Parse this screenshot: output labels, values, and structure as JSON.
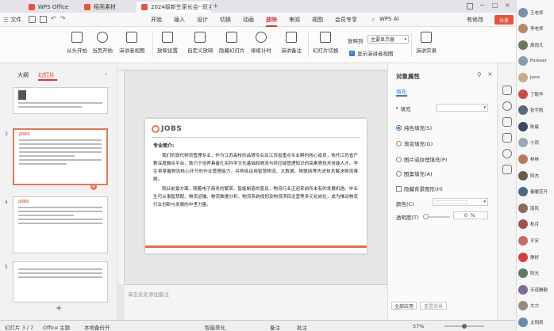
{
  "tabs": [
    {
      "label": "WPS Office",
      "color": "#e8523f"
    },
    {
      "label": "稻壳素材",
      "color": "#e8523f"
    },
    {
      "label": "2024级新生家长会--班主任",
      "color": "#e8523f"
    }
  ],
  "wps_ai": "WPS AI",
  "menu": {
    "file": "三 文件",
    "items": [
      "开始",
      "插入",
      "设计",
      "切换",
      "动画",
      "放映",
      "审阅",
      "视图",
      "会员专享"
    ],
    "active": "放映",
    "changes": "有修改",
    "share": "分享"
  },
  "ribbon": {
    "buttons": [
      "从头开始",
      "当页开始",
      "演讲者视图",
      "放映设置",
      "自定义放映",
      "隐藏幻灯片",
      "排练计时",
      "演讲备注",
      "幻灯片切换",
      "演讲实录"
    ],
    "monitor_label": "放映到",
    "monitor_value": "主要显示器",
    "presenter_view": "显示演讲者视图"
  },
  "left_panel": {
    "tab_outline": "大纲",
    "tab_slides": "幻灯片",
    "slide_numbers": [
      "3",
      "4",
      "5"
    ],
    "logo": "JOBS"
  },
  "slide": {
    "logo": "JOBS",
    "heading": "专业简介:",
    "para1": "我们的现代物流管理专业，作为江苏高校的品牌专业及江苏省重点专业群的核心成员，依托江苏省产教深度融合平台，致力于培养具备扎实科学文化基础和物流与供应链管理知识的高素质技术技能人才。学生将掌握物流核心环节的作业管理能力，并熟练运用智慧物流、大数据、物联网等先进技术解决物流难题。",
    "para2": "就业前景方面，随着电子商务的繁荣、智能制造的普及，物流行业正迎来前所未有的发展机遇。毕业生可从事智慧配、物流运输、物流数据分析、物流系统规划及物流项目运营等多元化岗位，成为推动物流行业创新与发展的中坚力量。"
  },
  "notes_placeholder": "单击此处添加备注",
  "right_panel": {
    "title": "对象属性",
    "tab_fill": "填充",
    "fill_label": "填充",
    "options": [
      "纯色填充(S)",
      "渐变填充(G)",
      "图片或纹理填充(P)",
      "图案填充(A)",
      "隐藏背景图形(H)"
    ],
    "selected": "纯色填充(S)",
    "color_label": "颜色(C)",
    "transparency_label": "透明度(T)",
    "transparency_value": "0",
    "transparency_unit": "%",
    "apply_all": "全部应用",
    "reset_bg": "重置背景"
  },
  "status": {
    "slide_count": "幻灯片 3 / 7",
    "theme": "Office 主题",
    "backup": "本地备份开",
    "beautify": "智能美化",
    "notes": "备注",
    "comment": "批注",
    "zoom": "57%"
  },
  "participants": [
    {
      "name": "王老师",
      "color": "#7a8fa8"
    },
    {
      "name": "李老师",
      "color": "#b08b6a"
    },
    {
      "name": "周雨凡",
      "color": "#6a7a5a"
    },
    {
      "name": "Forever",
      "color": "#8899aa"
    },
    {
      "name": "Juno",
      "color": "#c9a98a"
    },
    {
      "name": "丁毅华",
      "color": "#c94a4a"
    },
    {
      "name": "张宇航",
      "color": "#5a6a7a"
    },
    {
      "name": "陈晨",
      "color": "#3a4a5a"
    },
    {
      "name": "小雨",
      "color": "#9aaab9"
    },
    {
      "name": "林林",
      "color": "#b87a5a"
    },
    {
      "name": "阿杰",
      "color": "#6a5a4a"
    },
    {
      "name": "春暖花开",
      "color": "#4a6a8a"
    },
    {
      "name": "南风",
      "color": "#8a6a5a"
    },
    {
      "name": "秋月",
      "color": "#a05050"
    },
    {
      "name": "平安",
      "color": "#c07060"
    },
    {
      "name": "静好",
      "color": "#d04040"
    },
    {
      "name": "阳光",
      "color": "#5a7a6a"
    },
    {
      "name": "天道酬勤",
      "color": "#7a6a9a"
    },
    {
      "name": "大力",
      "color": "#9a8a7a"
    },
    {
      "name": "太阳雨",
      "color": "#6a8aaa"
    }
  ]
}
